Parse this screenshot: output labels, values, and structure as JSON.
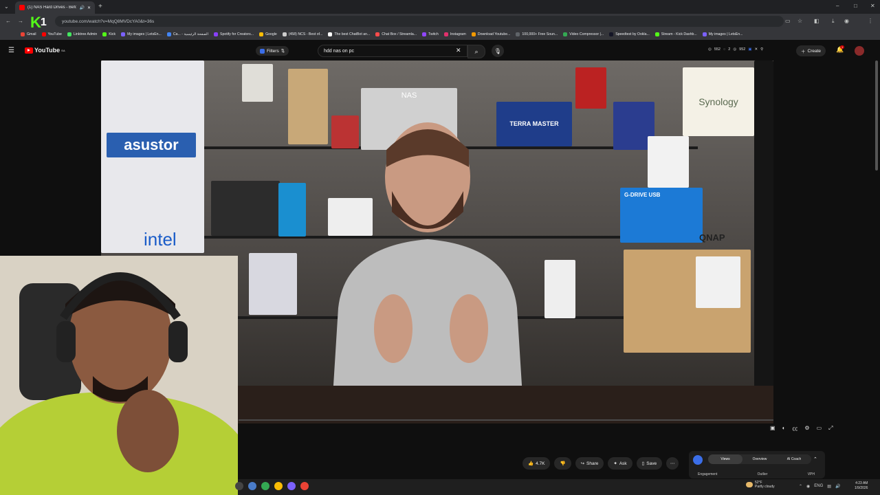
{
  "browser": {
    "tab_title": "(1) NAS Hard Drives - Befo",
    "url": "youtube.com/watch?v=MqQ8MVDcYA0&t=36s",
    "window_controls": [
      "–",
      "□",
      "✕"
    ],
    "bookmarks": [
      "Gmail",
      "YouTube",
      "Linktree Admin",
      "Kick",
      "My images | LetsEn...",
      "Ca... - الصفحة الرئيسية",
      "Spotify for Creators...",
      "Google",
      "(458) NCS - Best of...",
      "The best ChatBot an...",
      "Chat Box / Streamla...",
      "Twitch",
      "Instagram",
      "Download Youtube...",
      "100,000+ Free Soun...",
      "Video Compressor |...",
      "Speedtest by Ookla...",
      "Stream - Kick Dashb...",
      "My images | LetsEn..."
    ]
  },
  "overlay": {
    "k1_letter": "K",
    "k1_digit": "1"
  },
  "youtube": {
    "logo": "YouTube",
    "region": "SA",
    "filters_label": "Filters",
    "search_value": "hdd nas on pc",
    "stats": [
      "552",
      "2",
      "952"
    ],
    "create_label": "Create",
    "notification_count": "1"
  },
  "player": {
    "brand_text": [
      "asustor",
      "intel",
      "Synology",
      "TERRA MASTER",
      "G-DRIVE USB",
      "QNAP",
      "NAS"
    ]
  },
  "actions": {
    "like_count": "4.7K",
    "share_label": "Share",
    "ask_label": "Ask",
    "save_label": "Save"
  },
  "panel": {
    "tabs": [
      "Views",
      "Overview",
      "AI Coach"
    ],
    "columns": [
      "Engagement",
      "Outlier",
      "VPH"
    ]
  },
  "taskbar": {
    "weather_temp": "52°F",
    "weather_desc": "Partly cloudy",
    "lang": "ENG",
    "time": "4:23 AM",
    "date": "1/9/2026"
  }
}
